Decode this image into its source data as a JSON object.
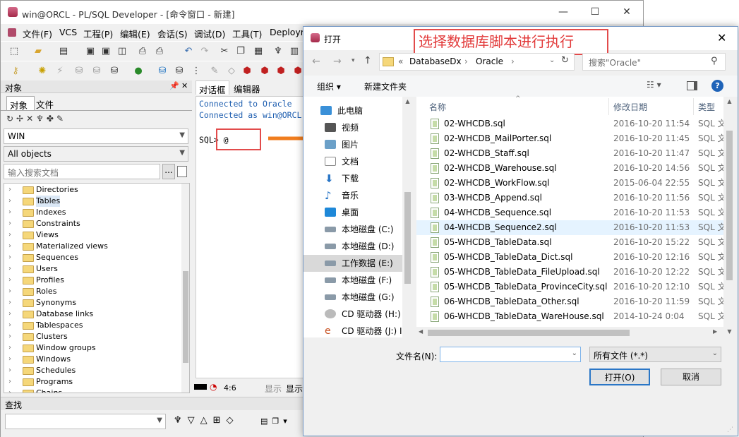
{
  "main_window": {
    "title": "win@ORCL - PL/SQL Developer - [命令窗口 - 新建]",
    "menu": [
      "文件(F)",
      "VCS",
      "工程(P)",
      "编辑(E)",
      "会话(S)",
      "调试(D)",
      "工具(T)",
      "Deploym"
    ]
  },
  "object_panel": {
    "title": "对象",
    "tabs": [
      "对象",
      "文件"
    ],
    "user_combo": "WIN",
    "filter_combo": "All objects",
    "search_placeholder": "输入搜索文档",
    "tree_items": [
      "Directories",
      "Tables",
      "Indexes",
      "Constraints",
      "Views",
      "Materialized views",
      "Sequences",
      "Users",
      "Profiles",
      "Roles",
      "Synonyms",
      "Database links",
      "Tablespaces",
      "Clusters",
      "Window groups",
      "Windows",
      "Schedules",
      "Programs",
      "Chains"
    ]
  },
  "sql_panel": {
    "tabs": [
      "对话框",
      "编辑器"
    ],
    "lines": [
      "Connected to Oracle",
      "Connected as win@ORCL"
    ],
    "prompt": "SQL> @",
    "status_pos": "4:6",
    "status_show1": "显示",
    "status_show2": "显示"
  },
  "find_bar": {
    "title": "查找"
  },
  "dialog": {
    "title": "打开",
    "annotation": "选择数据库脚本进行执行",
    "breadcrumb": [
      "«",
      "DatabaseDx",
      "Oracle"
    ],
    "search_placeholder": "搜索\"Oracle\"",
    "organize": "组织 ▾",
    "new_folder": "新建文件夹",
    "nav_items": [
      "此电脑",
      "视频",
      "图片",
      "文档",
      "下载",
      "音乐",
      "桌面",
      "本地磁盘 (C:)",
      "本地磁盘 (D:)",
      "工作数据 (E:)",
      "本地磁盘 (F:)",
      "本地磁盘 (G:)",
      "CD 驱动器 (H:)",
      "CD 驱动器 (J:) I"
    ],
    "columns": {
      "name": "名称",
      "date": "修改日期",
      "type": "类型"
    },
    "files": [
      {
        "name": "02-WHCDB.sql",
        "date": "2016-10-20 11:54",
        "type": "SQL 文"
      },
      {
        "name": "02-WHCDB_MailPorter.sql",
        "date": "2016-10-20 11:45",
        "type": "SQL 文"
      },
      {
        "name": "02-WHCDB_Staff.sql",
        "date": "2016-10-20 11:47",
        "type": "SQL 文"
      },
      {
        "name": "02-WHCDB_Warehouse.sql",
        "date": "2016-10-20 14:56",
        "type": "SQL 文"
      },
      {
        "name": "02-WHCDB_WorkFlow.sql",
        "date": "2015-06-04 22:55",
        "type": "SQL 文"
      },
      {
        "name": "03-WHCDB_Append.sql",
        "date": "2016-10-20 11:56",
        "type": "SQL 文"
      },
      {
        "name": "04-WHCDB_Sequence.sql",
        "date": "2016-10-20 11:53",
        "type": "SQL 文"
      },
      {
        "name": "04-WHCDB_Sequence2.sql",
        "date": "2016-10-20 11:53",
        "type": "SQL 文"
      },
      {
        "name": "05-WHCDB_TableData.sql",
        "date": "2016-10-20 15:22",
        "type": "SQL 文"
      },
      {
        "name": "05-WHCDB_TableData_Dict.sql",
        "date": "2016-10-20 12:16",
        "type": "SQL 文"
      },
      {
        "name": "05-WHCDB_TableData_FileUpload.sql",
        "date": "2016-10-20 12:22",
        "type": "SQL 文"
      },
      {
        "name": "05-WHCDB_TableData_ProvinceCity.sql",
        "date": "2016-10-20 12:10",
        "type": "SQL 文"
      },
      {
        "name": "06-WHCDB_TableData_Other.sql",
        "date": "2016-10-20 11:59",
        "type": "SQL 文"
      },
      {
        "name": "06-WHCDB_TableData_WareHouse.sql",
        "date": "2014-10-24 0:04",
        "type": "SQL 文"
      }
    ],
    "filename_label": "文件名(N):",
    "filename_value": "",
    "filetype": "所有文件 (*.*)",
    "open_button": "打开(O)",
    "cancel_button": "取消"
  },
  "colors": {
    "annotation": "#e24b4b",
    "arrow": "#f07d1e",
    "selected": "#cce8ff"
  }
}
